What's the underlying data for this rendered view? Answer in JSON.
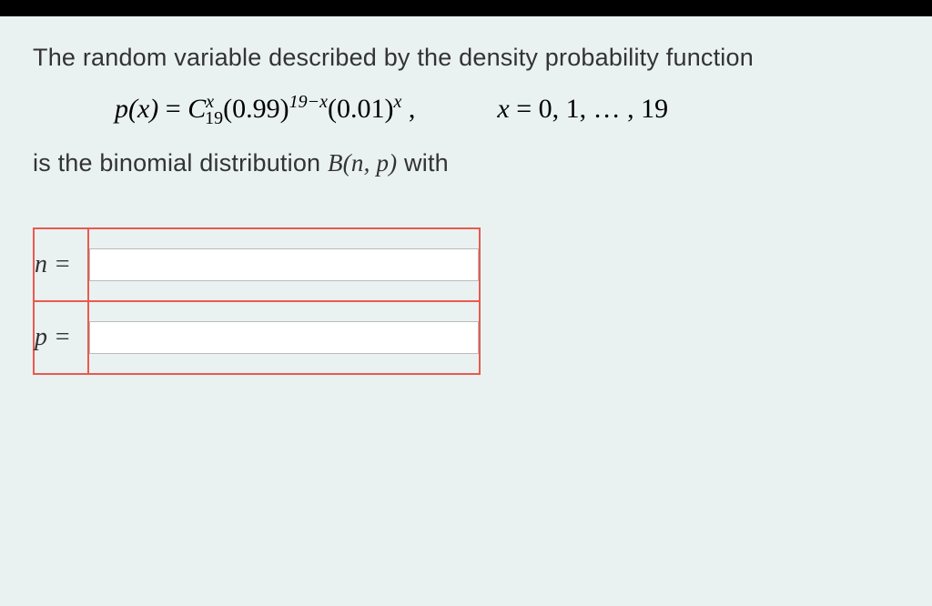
{
  "question": {
    "intro": "The random variable described by the density probability function",
    "formula_px_lhs": "p(x)",
    "formula_equals": " = ",
    "formula_C": "C",
    "formula_C_sub": "19",
    "formula_C_sup": "x",
    "formula_base1": "(0.99)",
    "formula_exp1": "19−x",
    "formula_base2": "(0.01)",
    "formula_exp2": "x",
    "formula_comma": " ,",
    "formula_x_eq": "x",
    "formula_x_vals": " = 0, 1, … , 19",
    "conclusion_pre": "is the binomial  distribution ",
    "conclusion_B": "B",
    "conclusion_np": "(n, p)",
    "conclusion_post": " with"
  },
  "answers": {
    "n_label": "n =",
    "p_label": "p =",
    "n_value": "",
    "p_value": ""
  }
}
